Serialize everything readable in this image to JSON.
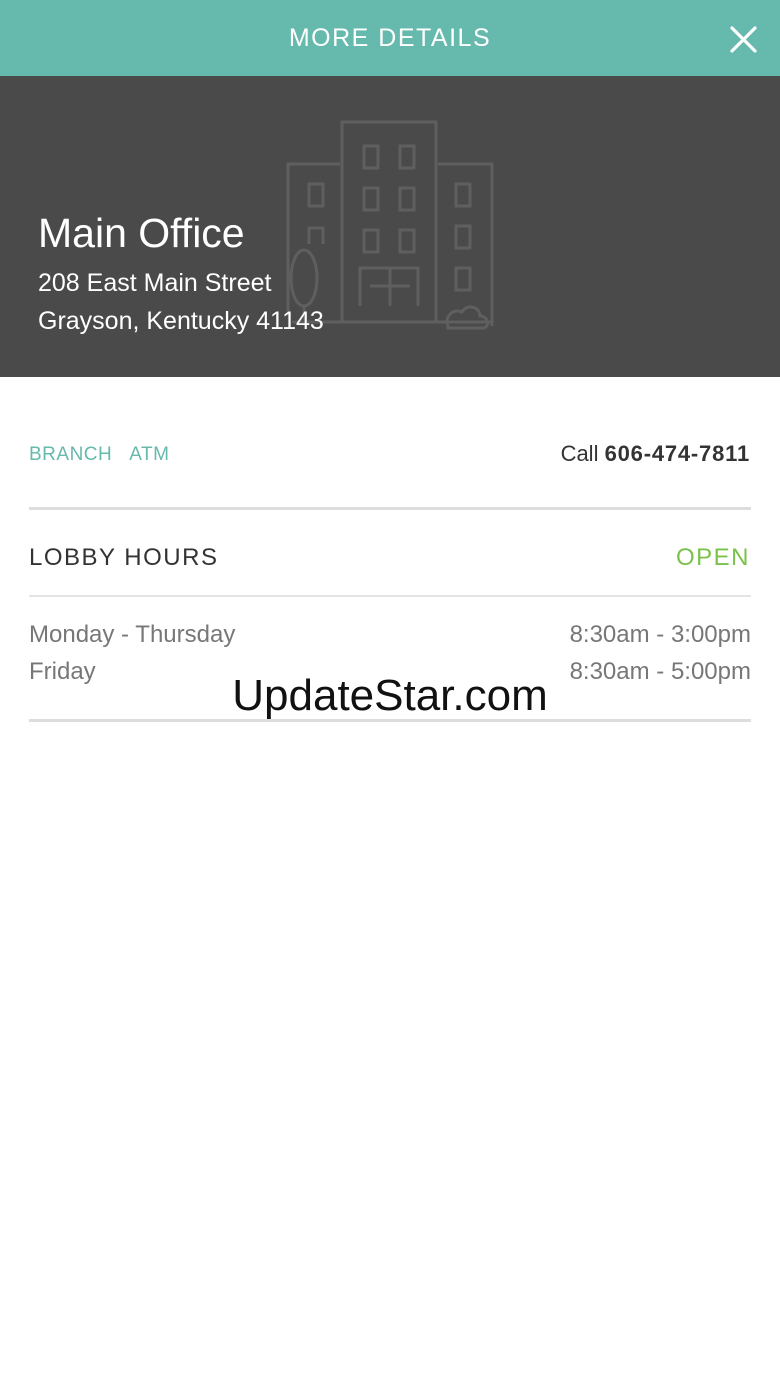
{
  "header": {
    "title": "MORE DETAILS",
    "close_icon": "close-icon",
    "background_color": "#66b9ad"
  },
  "hero": {
    "location_name": "Main Office",
    "address_line1": "208 East Main Street",
    "address_line2": "Grayson, Kentucky 41143",
    "icon": "building-icon",
    "background_color": "#4a4a4a"
  },
  "tags": {
    "branch": "BRANCH",
    "atm": "ATM",
    "color": "#66b9ad"
  },
  "call": {
    "prefix": "Call",
    "number": "606-474-7811"
  },
  "lobby": {
    "title": "LOBBY HOURS",
    "status": "OPEN",
    "status_color": "#7bc24a",
    "hours": [
      {
        "day": "Monday - Thursday",
        "time": "8:30am - 3:00pm"
      },
      {
        "day": "Friday",
        "time": "8:30am - 5:00pm"
      }
    ]
  },
  "watermark": "UpdateStar.com"
}
